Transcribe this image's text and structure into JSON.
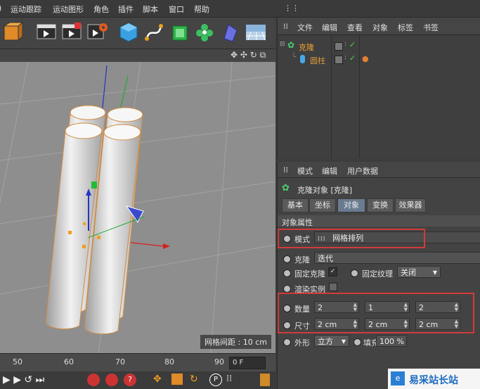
{
  "menu": [
    "运动跟踪",
    "运动图形",
    "角色",
    "插件",
    "脚本",
    "窗口",
    "帮助"
  ],
  "object_manager": {
    "tabs": [
      "文件",
      "编辑",
      "查看",
      "对象",
      "标签",
      "书签"
    ],
    "objects": [
      {
        "name": "克隆",
        "color": "#f0a030"
      },
      {
        "name": "圆柱",
        "color": "#e09a3a"
      }
    ]
  },
  "attributes": {
    "menu": [
      "模式",
      "编辑",
      "用户数据"
    ],
    "header": "克隆对象 [克隆]",
    "tabs": [
      "基本",
      "坐标",
      "对象",
      "变换",
      "效果器"
    ],
    "active_tab": "对象",
    "section": "对象属性",
    "mode_label": "模式",
    "mode_value": "网格排列",
    "clone_label": "克隆",
    "clone_value": "迭代",
    "fixed_clone_label": "固定克隆",
    "fixed_texture_label": "固定纹理",
    "fixed_texture_value": "关闭",
    "render_instance_label": "渲染实例",
    "count_label": "数量",
    "count_values": [
      "2",
      "1",
      "2"
    ],
    "size_label": "尺寸",
    "size_values": [
      "2 cm",
      "2 cm",
      "2 cm"
    ],
    "shape_label": "外形",
    "shape_value": "立方",
    "fill_label": "填充",
    "fill_value": "100 %"
  },
  "viewport": {
    "grid_spacing": "网格间距 : 10 cm"
  },
  "timeline": {
    "ticks": [
      "50",
      "60",
      "70",
      "80",
      "90"
    ],
    "frame": "0 F"
  },
  "watermark": "易采站长站",
  "colors": {
    "accent_red": "#d33a3a",
    "active_tab": "#6a7b91",
    "object_orange": "#f0a030"
  }
}
